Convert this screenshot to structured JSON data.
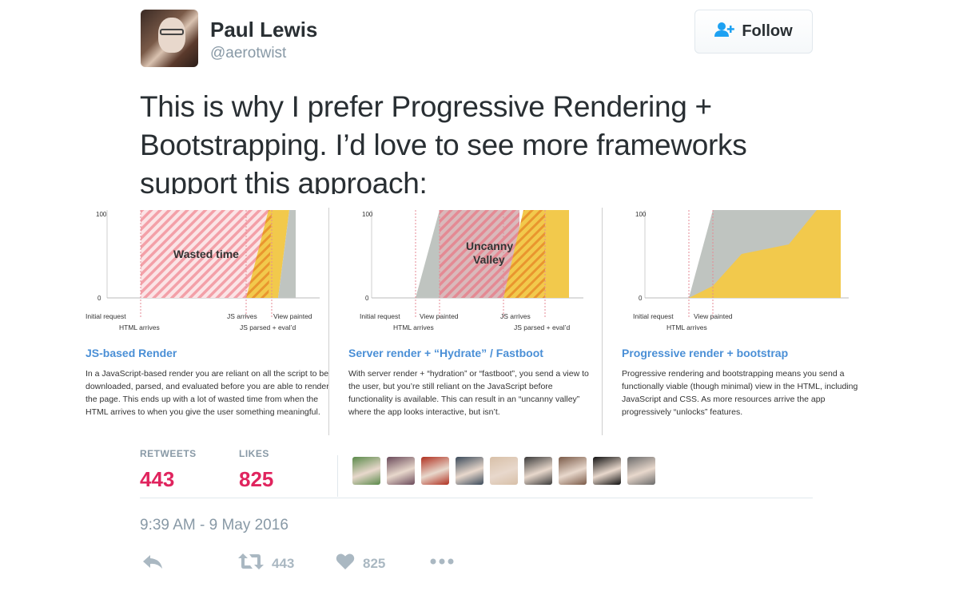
{
  "author": {
    "name": "Paul Lewis",
    "handle": "@aerotwist"
  },
  "follow_button": {
    "label": "Follow"
  },
  "tweet_text": "This is why I prefer Progressive Rendering + Bootstrapping. I’d love to see more frameworks support this approach:",
  "media": {
    "panels": [
      {
        "title": "JS-based Render",
        "description": "In a JavaScript-based render you are reliant on all the script to be downloaded, parsed, and evaluated before you are able to render the page. This ends up with a lot of wasted time from when the HTML arrives to when you give the user something meaningful.",
        "y_top": "100",
        "y_bottom": "0",
        "region_label": "Wasted time",
        "ticks": [
          "Initial request",
          "HTML arrives",
          "JS arrives",
          "View painted",
          "JS parsed + eval’d"
        ]
      },
      {
        "title": "Server render + “Hydrate” / Fastboot",
        "description": "With server render + “hydration” or “fastboot”, you send a view to the user, but you’re still reliant on the JavaScript before functionality is available. This can result in an “uncanny valley” where the app looks interactive, but isn’t.",
        "y_top": "100",
        "y_bottom": "0",
        "region_label_line1": "Uncanny",
        "region_label_line2": "Valley",
        "ticks": [
          "Initial request",
          "HTML arrives",
          "View painted",
          "JS arrives",
          "JS parsed + eval’d"
        ]
      },
      {
        "title": "Progressive render + bootstrap",
        "description": "Progressive rendering and bootstrapping means you send a functionally viable (though minimal) view in the HTML, including JavaScript and CSS. As more resources arrive the app progressively “unlocks” features.",
        "y_top": "100",
        "y_bottom": "0",
        "ticks": [
          "Initial request",
          "HTML arrives",
          "View painted"
        ]
      }
    ]
  },
  "stats": {
    "retweets_label": "RETWEETS",
    "retweets_value": "443",
    "likes_label": "LIKES",
    "likes_value": "825"
  },
  "likers_colors": [
    "#5a8a4a",
    "#6a4a5a",
    "#b03020",
    "#3a4a5a",
    "#d8c0a8",
    "#3a3a3a",
    "#7a5a48",
    "#111111",
    "#6a6a6a"
  ],
  "timestamp": "9:39 AM - 9 May 2016",
  "actions": {
    "retweet_count": "443",
    "like_count": "825"
  },
  "colors": {
    "accent_pink": "#e0245e",
    "chart_gray": "#bfc4c0",
    "chart_yellow": "#f2c94c",
    "hatch_pink": "#f3a0a8",
    "title_blue": "#4a8fd6"
  }
}
